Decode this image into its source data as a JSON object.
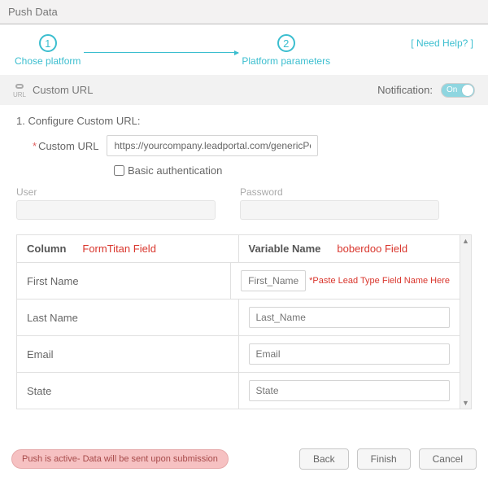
{
  "header": {
    "title": "Push Data"
  },
  "steps": {
    "s1": {
      "num": "1",
      "label": "Chose platform"
    },
    "s2": {
      "num": "2",
      "label": "Platform parameters"
    },
    "help": "[ Need Help? ]"
  },
  "band": {
    "iconText": "URL",
    "title": "Custom URL",
    "notifLabel": "Notification:",
    "toggleText": "On"
  },
  "form": {
    "sectionTitle": "1. Configure Custom URL:",
    "urlLabel": "Custom URL",
    "urlValue": "https://yourcompany.leadportal.com/genericPostlead.php",
    "basicAuth": "Basic authentication",
    "userLabel": "User",
    "passwordLabel": "Password"
  },
  "grid": {
    "colHeader": "Column",
    "colHeaderRed": "FormTitan Field",
    "varHeader": "Variable Name",
    "varHeaderRed": "boberdoo Field",
    "hint": "*Paste Lead Type Field Name Here",
    "rows": [
      {
        "label": "First Name",
        "placeholder": "First_Name"
      },
      {
        "label": "Last Name",
        "placeholder": "Last_Name"
      },
      {
        "label": "Email",
        "placeholder": "Email"
      },
      {
        "label": "State",
        "placeholder": "State"
      }
    ]
  },
  "footer": {
    "status": "Push is active- Data will be sent upon submission",
    "back": "Back",
    "finish": "Finish",
    "cancel": "Cancel"
  }
}
